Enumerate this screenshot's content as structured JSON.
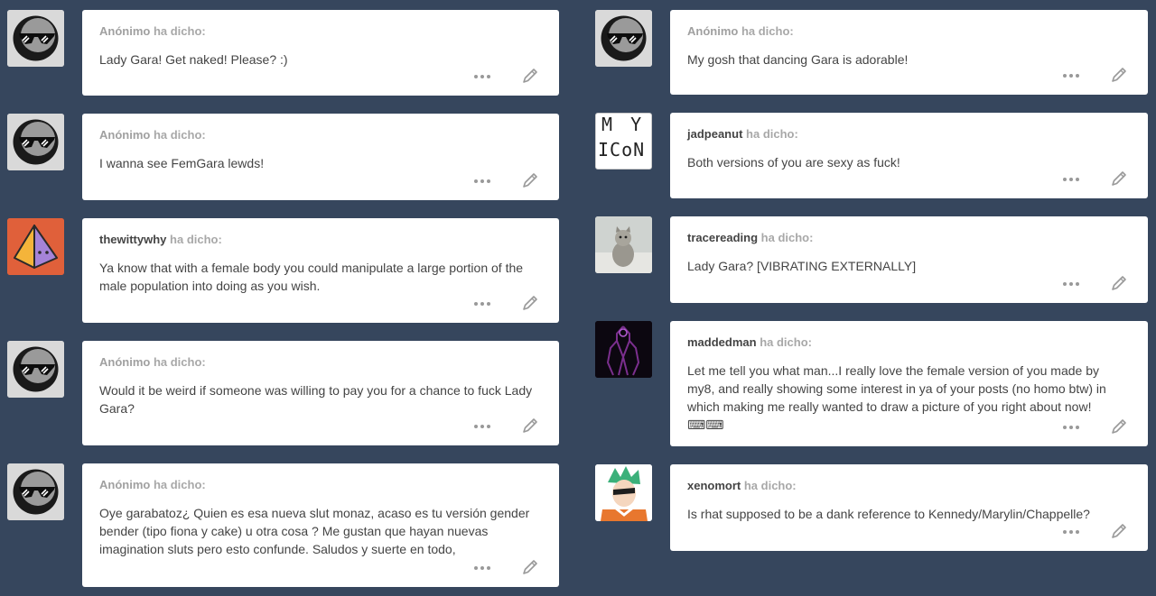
{
  "said_suffix": "ha dicho:",
  "left": [
    {
      "asker": "Anónimo",
      "anonymous": true,
      "avatar": "sunglasses-moon-avatar",
      "question": "Lady Gara! Get naked! Please? :)"
    },
    {
      "asker": "Anónimo",
      "anonymous": true,
      "avatar": "sunglasses-moon-avatar",
      "question": "I wanna see FemGara lewds!"
    },
    {
      "asker": "thewittywhy",
      "anonymous": false,
      "avatar": "pyramid-avatar",
      "question": "Ya know that with a female body you could manipulate a large portion of the male population into doing as you wish."
    },
    {
      "asker": "Anónimo",
      "anonymous": true,
      "avatar": "sunglasses-moon-avatar",
      "question": "Would it be weird if someone was willing to pay you for a chance to fuck Lady Gara?"
    },
    {
      "asker": "Anónimo",
      "anonymous": true,
      "avatar": "sunglasses-moon-avatar",
      "question": "Oye garabatoz¿ Quien es esa nueva slut monaz, acaso es tu versión gender bender (tipo fiona y cake) u otra cosa ? Me gustan que hayan nuevas imagination sluts pero esto confunde. Saludos y suerte en todo,"
    }
  ],
  "right": [
    {
      "asker": "Anónimo",
      "anonymous": true,
      "avatar": "sunglasses-moon-avatar",
      "question": "My gosh that dancing Gara is adorable!"
    },
    {
      "asker": "jadpeanut",
      "anonymous": false,
      "avatar": "my-icon-avatar",
      "avatar_text": [
        "M Y",
        "ICoN"
      ],
      "question": "Both versions of you are sexy as fuck!"
    },
    {
      "asker": "tracereading",
      "anonymous": false,
      "avatar": "kitten-photo-avatar",
      "question": "Lady Gara? [VIBRATING EXTERNALLY]"
    },
    {
      "asker": "maddedman",
      "anonymous": false,
      "avatar": "dark-figure-avatar",
      "question": "Let me tell you what man...I really love the female version of you made by my8, and really showing some interest in ya of your posts (no homo btw) in which making me really wanted to draw a picture of you right about now! ⌨⌨"
    },
    {
      "asker": "xenomort",
      "anonymous": false,
      "avatar": "anime-character-avatar",
      "question": "Is rhat supposed to be a dank reference to Kennedy/Marylin/Chappelle?"
    }
  ]
}
